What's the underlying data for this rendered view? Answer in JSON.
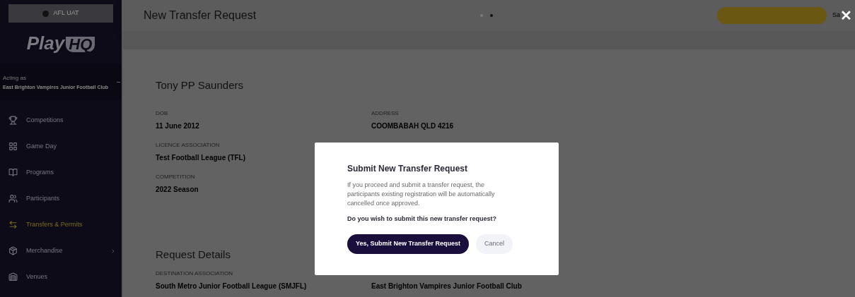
{
  "sidebar": {
    "environment": "AFL UAT",
    "logo": {
      "word": "Play",
      "badge": "HQ"
    },
    "acting_label": "Acting as",
    "organisation": "East Brighton Vampires Junior Football Club",
    "items": [
      {
        "label": "Competitions",
        "selected": false,
        "has_submenu": false
      },
      {
        "label": "Game Day",
        "selected": false,
        "has_submenu": false
      },
      {
        "label": "Programs",
        "selected": false,
        "has_submenu": false
      },
      {
        "label": "Participants",
        "selected": false,
        "has_submenu": false
      },
      {
        "label": "Transfers & Permits",
        "selected": true,
        "has_submenu": false
      },
      {
        "label": "Merchandise",
        "selected": false,
        "has_submenu": true
      },
      {
        "label": "Venues",
        "selected": false,
        "has_submenu": false
      }
    ]
  },
  "header": {
    "title": "New Transfer Request",
    "save_label": "Sa"
  },
  "participant": {
    "name": "Tony PP Saunders",
    "columns": [
      [
        {
          "label": "DOB",
          "value": "11 June 2012"
        },
        {
          "label": "LICENCE ASSOCIATION",
          "value": "Test Football League (TFL)"
        },
        {
          "label": "COMPETITION",
          "value": "2022 Season"
        }
      ],
      [
        {
          "label": "ADDRESS",
          "value": "COOMBABAH QLD 4216"
        }
      ]
    ]
  },
  "request_details": {
    "title": "Request Details",
    "fields": [
      {
        "label": "DESTINATION ASSOCIATION",
        "value": "South Metro Junior Football League (SMJFL)"
      },
      {
        "value": "East Brighton Vampires Junior Football Club"
      }
    ]
  },
  "dialog": {
    "title": "Submit New Transfer Request",
    "message": "If you proceed and submit a transfer request, the participants existing registration will be automatically cancelled once approved.",
    "question": "Do you wish to submit this new transfer request?",
    "confirm": "Yes, Submit New Transfer Request",
    "cancel": "Cancel",
    "close": "✕"
  }
}
